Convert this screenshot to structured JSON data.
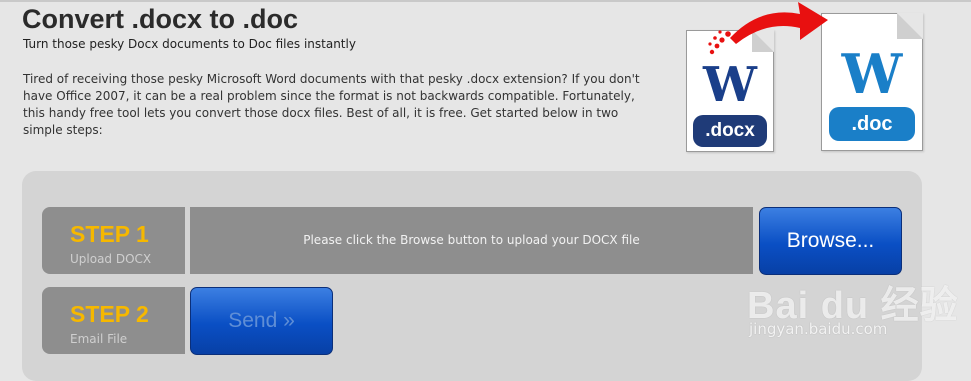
{
  "header": {
    "title": "Convert .docx to .doc",
    "subtitle": "Turn those pesky Docx documents to Doc files instantly",
    "intro": "Tired of receiving those pesky Microsoft Word documents with that pesky .docx extension? If you don't have Office 2007, it can be a real problem since the format is not backwards compatible. Fortunately, this handy free tool lets you convert those docx files. Best of all, it is free. Get started below in two simple steps:"
  },
  "icons": {
    "source_letter": "W",
    "source_ext": ".docx",
    "target_letter": "W",
    "target_ext": ".doc",
    "source_color": "#1f3b78",
    "target_color": "#1a7fc8",
    "arrow_color": "#e81010"
  },
  "steps": [
    {
      "number": "STEP 1",
      "label": "Upload DOCX"
    },
    {
      "number": "STEP 2",
      "label": "Email File"
    }
  ],
  "upload": {
    "instruction": "Please click the Browse button to upload your DOCX file",
    "browse_label": "Browse..."
  },
  "send": {
    "label": "Send »"
  },
  "watermark": {
    "logo": "Bai du 经验",
    "url": "jingyan.baidu.com"
  }
}
